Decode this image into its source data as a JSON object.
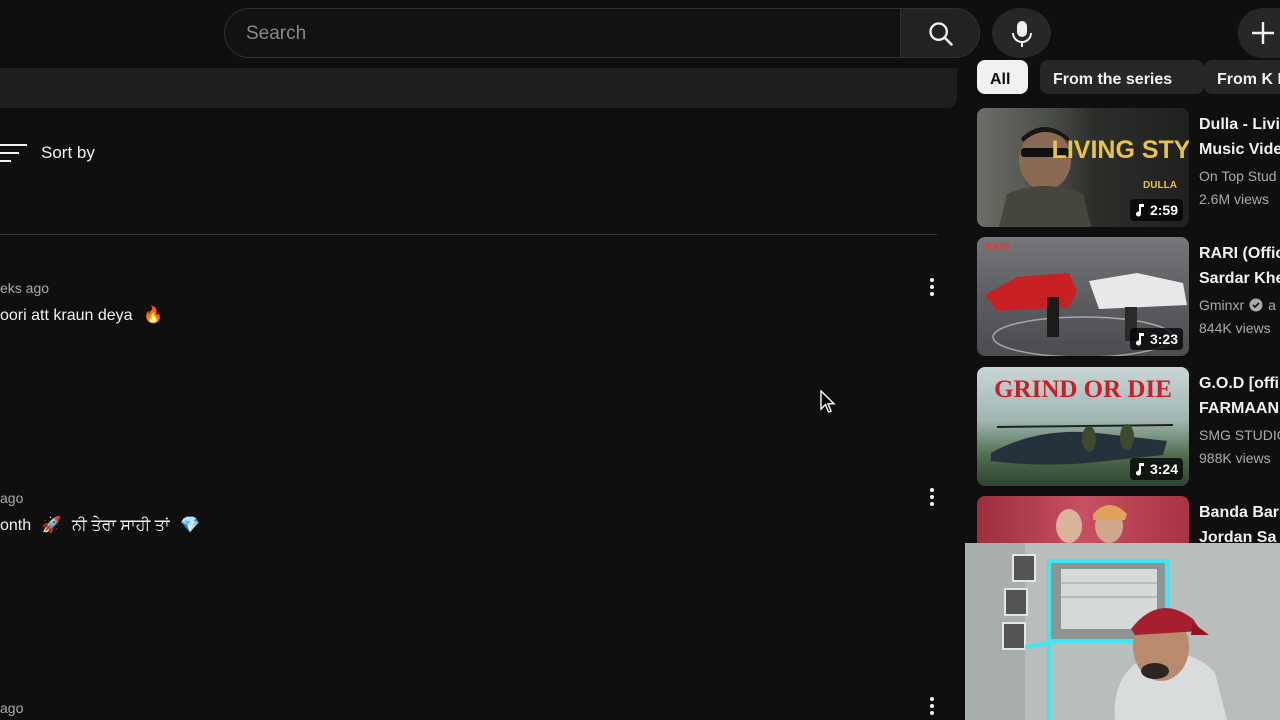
{
  "search": {
    "placeholder": "Search"
  },
  "comments": {
    "sort_label": "Sort by",
    "items": [
      {
        "meta": "eks ago",
        "text": "oori att kraun deya",
        "emoji": "🔥"
      },
      {
        "meta": "ago",
        "text": "onth",
        "emoji": "🚀",
        "text2": "ਨੀ ਤੇਰਾ ਸਾਹੀ ਤਾਂ",
        "emoji2": "💎"
      },
      {
        "meta": "ago"
      }
    ]
  },
  "chips": [
    "All",
    "From the series",
    "From K I"
  ],
  "recommended": [
    {
      "title": "Dulla - Livi\nMusic Vide",
      "channel": "On Top Stud",
      "views": "2.6M views",
      "duration": "2:59",
      "thumb_text": "LIVING STYLE",
      "thumb_sub": "DULLA"
    },
    {
      "title": "RARI (Offic\nSardar Khe",
      "channel": "Gminxr",
      "channel_suffix": "a",
      "views": "844K views",
      "duration": "3:23",
      "thumb_text": "RARI"
    },
    {
      "title": "G.O.D [offi\nFARMAAN",
      "channel": "SMG STUDIO",
      "views": "988K views",
      "duration": "3:24",
      "thumb_text": "GRIND OR DIE"
    },
    {
      "title": "Banda Bar\nJordan Sa"
    }
  ],
  "colors": {
    "background": "#0f0f0f",
    "chip_active": "#f1f1f1",
    "chip": "#272727",
    "secondary_text": "#aaaaaa",
    "led_strip": "#3ee6f2"
  },
  "icons": [
    "search-icon",
    "mic-icon",
    "create-icon",
    "sort-icon",
    "more-vert-icon",
    "music-note-icon",
    "verified-icon",
    "cursor-icon"
  ]
}
